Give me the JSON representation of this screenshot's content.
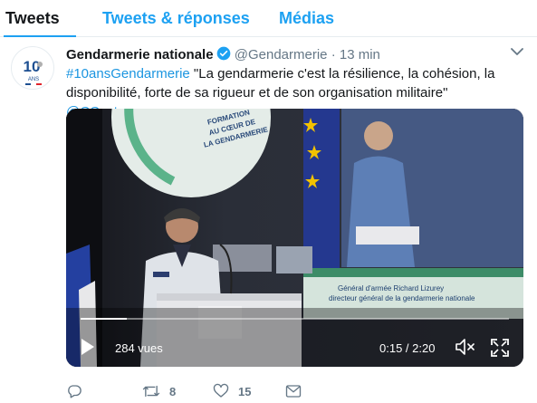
{
  "tabs": [
    {
      "label": "Tweets",
      "active": true
    },
    {
      "label": "Tweets & réponses",
      "active": false
    },
    {
      "label": "Médias",
      "active": false
    }
  ],
  "tweet": {
    "avatar": {
      "number": "10",
      "sub": "ANS"
    },
    "name": "Gendarmerie nationale",
    "verified": true,
    "handle": "@Gendarmerie",
    "separator": "·",
    "time": "13 min",
    "hashtag": "#10ansGendarmerie",
    "quote": " \"La gendarmerie c'est la résilience, la cohésion, la disponibilité, forte de sa rigueur et de son organisation militaire\" ",
    "mention": "@CCastaner",
    "video": {
      "banner_lines": [
        "FORMATION",
        "AU CŒUR DE",
        "LA GENDARMERIE"
      ],
      "caption_lines": [
        "Général d'armée Richard Lizurey",
        "directeur général de la gendarmerie nationale"
      ],
      "views": "284 vues",
      "time": "0:15 / 2:20",
      "progress_fraction": 0.107
    },
    "actions": {
      "reply_count": "",
      "retweet_count": "8",
      "like_count": "15"
    }
  },
  "colors": {
    "accent": "#1da1f2",
    "link": "#1b95e0",
    "muted": "#657786",
    "text": "#14171a"
  },
  "icons": [
    "verified-icon",
    "caret-down-icon",
    "play-icon",
    "mute-icon",
    "fullscreen-icon",
    "reply-icon",
    "retweet-icon",
    "like-icon",
    "dm-icon"
  ]
}
